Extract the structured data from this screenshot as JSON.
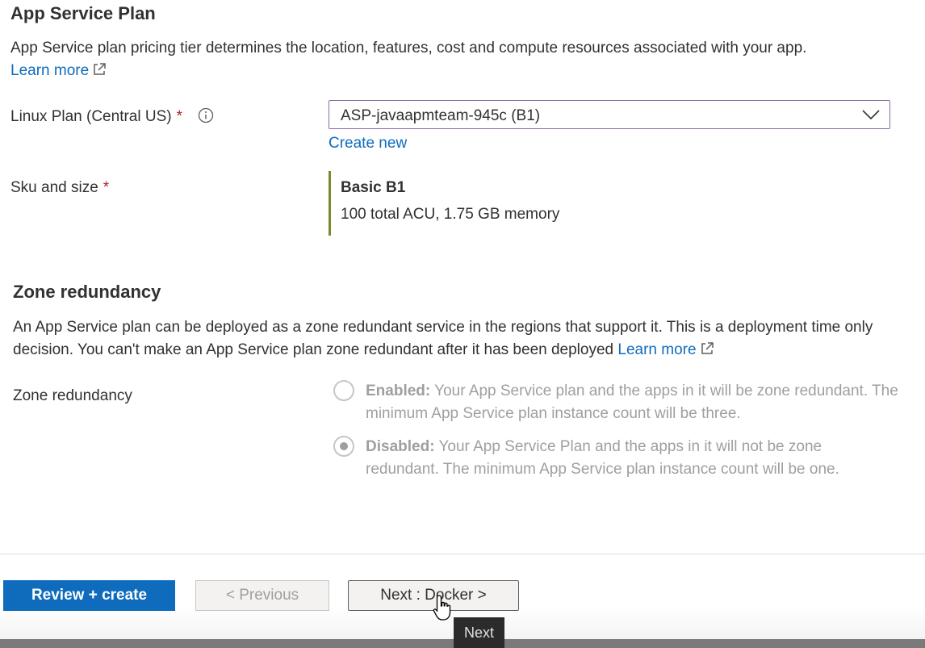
{
  "plan_section": {
    "title": "App Service Plan",
    "description": "App Service plan pricing tier determines the location, features, cost and compute resources associated with your app.",
    "learn_more": "Learn more"
  },
  "linux_plan": {
    "label": "Linux Plan (Central US)",
    "required_mark": "*",
    "selected_value": "ASP-javaapmteam-945c (B1)",
    "create_new": "Create new"
  },
  "sku": {
    "label": "Sku and size",
    "required_mark": "*",
    "name": "Basic B1",
    "description": "100 total ACU, 1.75 GB memory"
  },
  "zone_section": {
    "title": "Zone redundancy",
    "description": "An App Service plan can be deployed as a zone redundant service in the regions that support it. This is a deployment time only decision. You can't make an App Service plan zone redundant after it has been deployed",
    "learn_more": "Learn more",
    "field_label": "Zone redundancy",
    "options": [
      {
        "title": "Enabled:",
        "text": "Your App Service plan and the apps in it will be zone redundant. The minimum App Service plan instance count will be three.",
        "selected": false
      },
      {
        "title": "Disabled:",
        "text": "Your App Service Plan and the apps in it will not be zone redundant. The minimum App Service plan instance count will be one.",
        "selected": true
      }
    ]
  },
  "footer": {
    "review_create": "Review + create",
    "previous": "< Previous",
    "next": "Next : Docker >",
    "tooltip": "Next"
  },
  "colors": {
    "primary": "#0f6cbd",
    "link": "#0f6cbd",
    "required": "#a4262c",
    "sku_accent": "#7a8a2a",
    "dropdown_border": "#8a6aa8"
  },
  "icons": {
    "external_link": "external-link-icon",
    "info": "info-icon",
    "chevron": "chevron-down-icon",
    "cursor": "hand-cursor-icon"
  }
}
